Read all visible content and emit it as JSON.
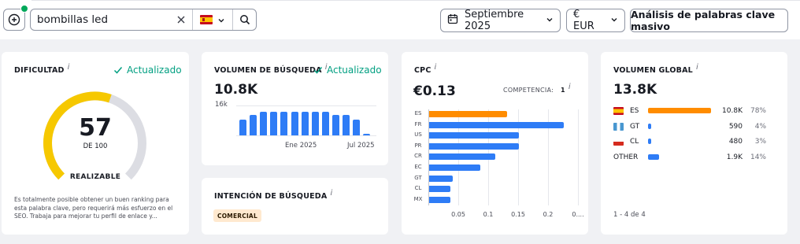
{
  "toolbar": {
    "search_value": "bombillas led",
    "date_label": "Septiembre 2025",
    "currency_label": "€ EUR",
    "bulk_label": "Análisis de palabras clave masivo"
  },
  "difficulty": {
    "title": "DIFICULTAD",
    "info": "i",
    "updated": "Actualizado",
    "value": "57",
    "of": "DE 100",
    "level": "REALIZABLE",
    "gauge_fraction": 0.57,
    "description": "Es totalmente posible obtener un buen ranking para esta palabra clave, pero requerirá más esfuerzo en el SEO. Trabaja para mejorar tu perfil de enlace y..."
  },
  "volume": {
    "title": "VOLUMEN DE BÚSQUEDA",
    "info": "i",
    "updated": "Actualizado",
    "value": "10.8K",
    "y_tick": "16k",
    "x_ticks": [
      "Ene 2025",
      "Jul 2025"
    ]
  },
  "intent": {
    "title": "INTENCIÓN DE BÚSQUEDA",
    "info": "i",
    "badge": "COMERCIAL"
  },
  "cpc": {
    "title": "CPC",
    "info": "i",
    "value": "€0.13",
    "competition_label": "COMPETENCIA:",
    "competition_value": "1",
    "competition_info": "i"
  },
  "global": {
    "title": "VOLUMEN GLOBAL",
    "info": "i",
    "value": "13.8K",
    "rows": [
      {
        "code": "ES",
        "value": "10.8K",
        "pct": "78%",
        "share": 0.78,
        "color": "#ff8c00",
        "flag": "es"
      },
      {
        "code": "GT",
        "value": "590",
        "pct": "4%",
        "share": 0.04,
        "color": "#2e7cf6",
        "flag": "gt"
      },
      {
        "code": "CL",
        "value": "480",
        "pct": "3%",
        "share": 0.03,
        "color": "#2e7cf6",
        "flag": "cl"
      },
      {
        "code": "OTHER",
        "value": "1.9K",
        "pct": "14%",
        "share": 0.14,
        "color": "#2e7cf6",
        "flag": ""
      }
    ],
    "pager": "1 - 4 de 4"
  },
  "colors": {
    "accent_blue": "#2e7cf6",
    "orange": "#ff8c00",
    "gauge_yellow": "#f6c800",
    "gauge_track": "#dcdde3",
    "green": "#009f81"
  },
  "chart_data": [
    {
      "type": "bar",
      "title": "VOLUMEN DE BÚSQUEDA",
      "categories": [
        "",
        "",
        "",
        "",
        "",
        "",
        "",
        "",
        "",
        "",
        "",
        "",
        ""
      ],
      "values": [
        8.6,
        11.0,
        12.7,
        12.7,
        12.7,
        12.7,
        12.5,
        12.7,
        12.5,
        10.9,
        10.9,
        8.6,
        1.0
      ],
      "y_tick_labels": [
        "16k"
      ],
      "x_tick_labels": [
        "Ene 2025",
        "Jul 2025"
      ],
      "ylim": [
        0,
        16
      ]
    },
    {
      "type": "bar",
      "orientation": "horizontal",
      "title": "CPC",
      "categories": [
        "ES",
        "FR",
        "US",
        "PR",
        "CR",
        "EC",
        "GT",
        "CL",
        "MX"
      ],
      "values": [
        0.13,
        0.225,
        0.15,
        0.15,
        0.11,
        0.085,
        0.04,
        0.035,
        0.035
      ],
      "highlight": "ES",
      "x_tick_labels": [
        "0.05",
        "0.1",
        "0.15",
        "0.2",
        "0...."
      ],
      "xlim": [
        0,
        0.25
      ]
    }
  ]
}
